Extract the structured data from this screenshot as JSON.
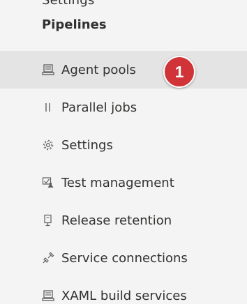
{
  "top_cut_label": "Settings",
  "section_header": "Pipelines",
  "callout": {
    "number": "1",
    "color": "#d13438"
  },
  "nav": {
    "items": [
      {
        "label": "Agent pools",
        "icon": "server-icon",
        "selected": true
      },
      {
        "label": "Parallel jobs",
        "icon": "parallel-icon",
        "selected": false
      },
      {
        "label": "Settings",
        "icon": "gear-icon",
        "selected": false
      },
      {
        "label": "Test management",
        "icon": "test-management-icon",
        "selected": false
      },
      {
        "label": "Release retention",
        "icon": "retention-icon",
        "selected": false
      },
      {
        "label": "Service connections",
        "icon": "plug-icon",
        "selected": false
      },
      {
        "label": "XAML build services",
        "icon": "server-icon",
        "selected": false
      }
    ]
  }
}
